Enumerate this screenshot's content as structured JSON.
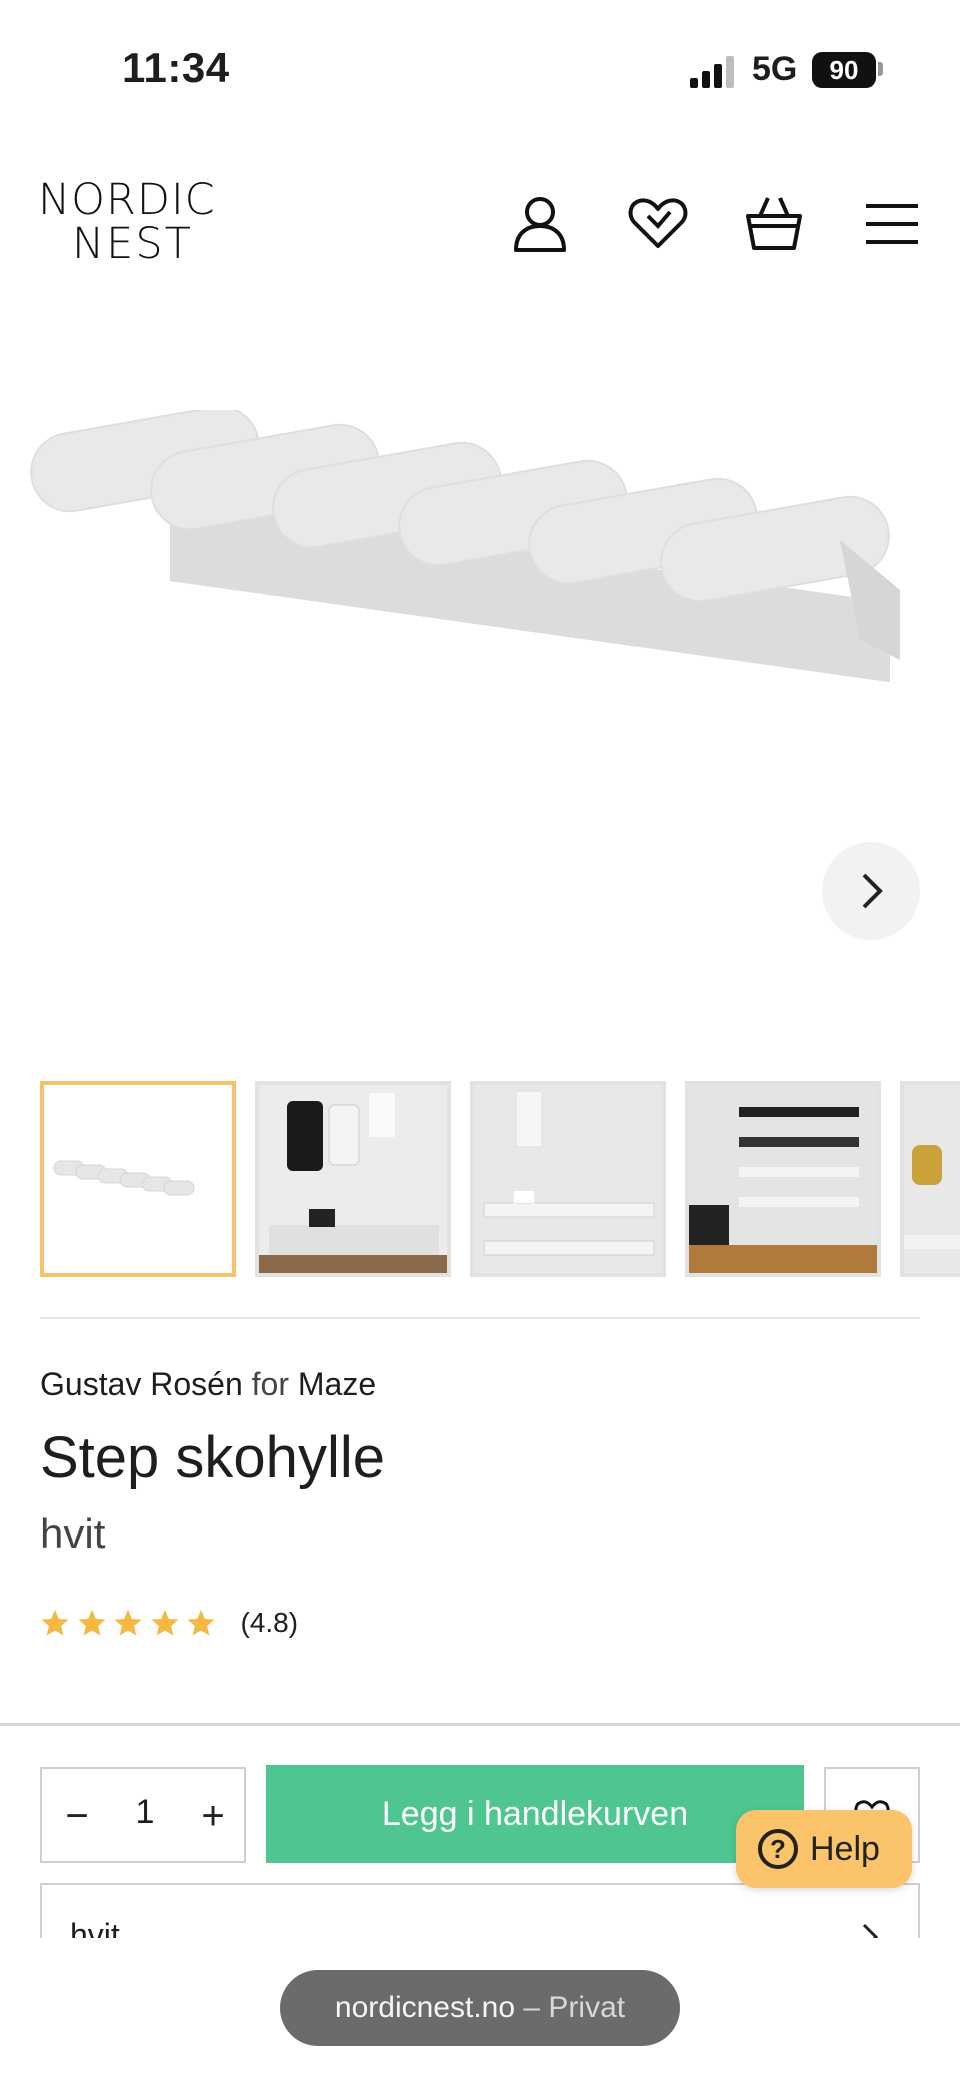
{
  "status_bar": {
    "time": "11:34",
    "network": "5G",
    "battery": "90"
  },
  "header": {
    "logo_line1": "NORDIC",
    "logo_line2": "NEST",
    "icons": [
      "account-icon",
      "wishlist-icon",
      "cart-icon",
      "menu-icon"
    ]
  },
  "gallery": {
    "thumbnail_count": 5,
    "selected_index": 0
  },
  "product": {
    "designer": "Gustav Rosén",
    "for_word": "for",
    "brand": "Maze",
    "title": "Step skohylle",
    "color": "hvit",
    "rating_stars": 5,
    "rating_value": "(4.8)"
  },
  "buy": {
    "quantity": "1",
    "minus": "−",
    "plus": "+",
    "add_to_cart": "Legg i handlekurven",
    "variant_label": "hvit"
  },
  "help": {
    "label": "Help",
    "q": "?"
  },
  "browser": {
    "domain": "nordicnest.no",
    "sep": "–",
    "mode": "Privat"
  },
  "colors": {
    "add_button": "#4fc68f",
    "help_button": "#fbc46a",
    "active_thumb_border": "#f5c26b",
    "star": "#f5b942"
  }
}
